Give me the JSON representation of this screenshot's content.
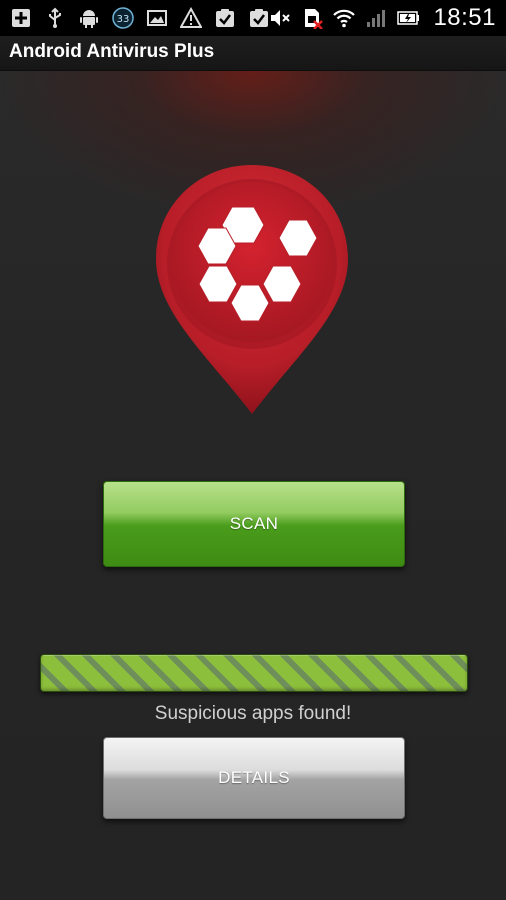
{
  "status_bar": {
    "left_icons": [
      "add-icon",
      "usb-icon",
      "android-icon",
      "notification-count-icon",
      "image-icon",
      "warning-icon",
      "task-check-icon",
      "task-check-icon"
    ],
    "notification_count": "33",
    "right_icons": [
      "mute-icon",
      "sim-no-signal-icon",
      "wifi-icon",
      "signal-icon",
      "battery-icon"
    ],
    "time": "18:51"
  },
  "app": {
    "title": "Android Antivirus Plus"
  },
  "main": {
    "scan_label": "SCAN",
    "progress": 1.0,
    "status_text": "Suspicious apps found!",
    "details_label": "DETAILS"
  },
  "colors": {
    "accent_green": "#4a9c1c",
    "logo_red": "#c4202a",
    "background": "#262626"
  }
}
